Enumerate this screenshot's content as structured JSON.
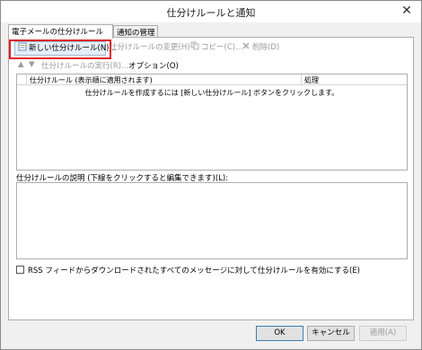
{
  "window": {
    "title": "仕分けルールと通知",
    "close_glyph": "✕"
  },
  "tabs": [
    {
      "label": "電子メールの仕分けルール"
    },
    {
      "label": "通知の管理"
    }
  ],
  "toolbar": {
    "new_rule_label": "新しい仕分けルール(N)...",
    "change_rule_label": "仕分けルールの変更(H)",
    "copy_label": "コピー(C)...",
    "delete_label": "削除(D)",
    "run_rules_label": "仕分けルールの実行(R)...",
    "options_label": "オプション(O)"
  },
  "rules_list": {
    "columns": [
      "仕分けルール (表示順に適用されます)",
      "処理"
    ],
    "empty_message": "仕分けルールを作成するには [新しい仕分けルール] ボタンをクリックします。"
  },
  "description": {
    "label": "仕分けルールの説明 (下線をクリックすると編集できます)(L):"
  },
  "rss": {
    "label": "RSS フィードからダウンロードされたすべてのメッセージに対して仕分けルールを有効にする(E)",
    "checked": false
  },
  "buttons": {
    "ok": "OK",
    "cancel": "キャンセル",
    "apply": "適用(A)"
  },
  "colors": {
    "highlight": "#e02020",
    "disabled_text": "#9a9a9a"
  }
}
